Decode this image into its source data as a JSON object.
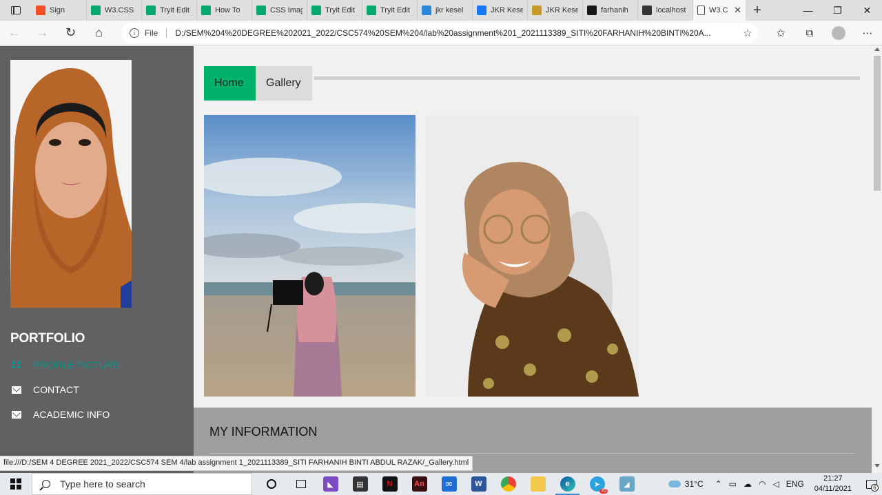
{
  "browser": {
    "tabs": [
      {
        "label": "Sign",
        "icon": "windows-icon",
        "color": "#f25022"
      },
      {
        "label": "W3.CSS",
        "icon": "w3schools-icon",
        "color": "#04aa6d"
      },
      {
        "label": "Tryit Edit",
        "icon": "w3schools-icon",
        "color": "#04aa6d"
      },
      {
        "label": "How To",
        "icon": "w3schools-icon",
        "color": "#04aa6d"
      },
      {
        "label": "CSS Imag",
        "icon": "w3schools-icon",
        "color": "#04aa6d"
      },
      {
        "label": "Tryit Edit",
        "icon": "w3schools-icon",
        "color": "#04aa6d"
      },
      {
        "label": "Tryit Edit",
        "icon": "w3schools-icon",
        "color": "#04aa6d"
      },
      {
        "label": "jkr kesel",
        "icon": "bing-icon",
        "color": "#2b88d8"
      },
      {
        "label": "JKR Kese",
        "icon": "facebook-icon",
        "color": "#1877f2"
      },
      {
        "label": "JKR Kese",
        "icon": "page-icon",
        "color": "#c59a2a"
      },
      {
        "label": "farhanih",
        "icon": "github-icon",
        "color": "#181717"
      },
      {
        "label": "localhost",
        "icon": "page-icon",
        "color": "#333333"
      }
    ],
    "active_tab": {
      "label": "W3.C",
      "close": "✕"
    },
    "new_tab": "+",
    "window_controls": {
      "minimize": "—",
      "maximize": "❐",
      "close": "✕"
    },
    "file_label": "File",
    "url": "D:/SEM%204%20DEGREE%202021_2022/CSC574%20SEM%204/lab%20assignment%201_2021113389_SITI%20FARHANIH%20BINTI%20A...",
    "status_url": "file:///D:/SEM 4 DEGREE 2021_2022/CSC574 SEM 4/lab assignment 1_2021113389_SITI FARHANIH BINTI ABDUL RAZAK/_Gallery.html"
  },
  "sidebar": {
    "title": "PORTFOLIO",
    "items": [
      {
        "label": "PROFILE PICTURE",
        "icon": "grid-icon",
        "active": true
      },
      {
        "label": "CONTACT",
        "icon": "envelope-icon",
        "active": false
      },
      {
        "label": "ACADEMIC INFO",
        "icon": "envelope-icon",
        "active": false
      }
    ]
  },
  "main": {
    "nav": [
      {
        "label": "Home",
        "active": true
      },
      {
        "label": "Gallery",
        "active": false
      }
    ],
    "info_title": "MY INFORMATION"
  },
  "taskbar": {
    "search_placeholder": "Type here to search",
    "temperature": "31°C",
    "language": "ENG",
    "time": "21:27",
    "date": "04/11/2021",
    "notification_count": "6",
    "telegram_badge": "70"
  },
  "colors": {
    "accent": "#00b26b",
    "sidebar_bg": "#616161",
    "sidebar_active": "#009688",
    "info_bar": "#9e9e9e"
  }
}
